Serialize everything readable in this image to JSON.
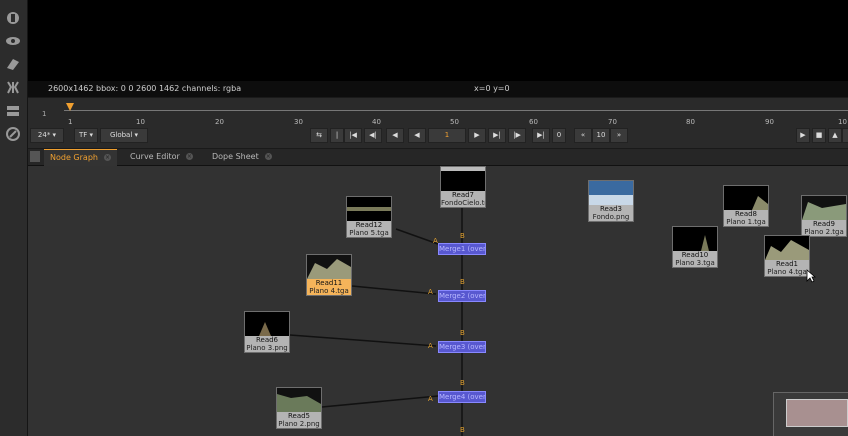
{
  "viewer": {
    "info_left": "2600x1462  bbox: 0 0 2600 1462 channels: rgba",
    "info_coords": "x=0 y=0"
  },
  "timeline": {
    "frame_start": "1",
    "ticks": [
      "1",
      "10",
      "20",
      "30",
      "40",
      "50",
      "60",
      "70",
      "80",
      "90",
      "10"
    ],
    "fps": "24*",
    "tf": "TF",
    "scope": "Global",
    "current_frame": "1",
    "end_marker": "0",
    "skip_value": "10"
  },
  "tabs": [
    {
      "label": "Node Graph",
      "active": true
    },
    {
      "label": "Curve Editor",
      "active": false
    },
    {
      "label": "Dope Sheet",
      "active": false
    }
  ],
  "nodes": [
    {
      "name": "Read7",
      "file": "FondoCielo.tga"
    },
    {
      "name": "Read12",
      "file": "Plano 5.tga"
    },
    {
      "name": "Read11",
      "file": "Plano 4.tga"
    },
    {
      "name": "Read6",
      "file": "Plano 3.png"
    },
    {
      "name": "Read5",
      "file": "Plano 2.png"
    },
    {
      "name": "Read3",
      "file": "Fondo.png"
    },
    {
      "name": "Read8",
      "file": "Plano 1.tga"
    },
    {
      "name": "Read10",
      "file": "Plano 3.tga"
    },
    {
      "name": "Read1",
      "file": "Plano 4.tga"
    },
    {
      "name": "Read9",
      "file": "Plano 2.tga"
    }
  ],
  "merges": [
    {
      "label": "Merge1 (over)"
    },
    {
      "label": "Merge2 (over)"
    },
    {
      "label": "Merge3 (over)"
    },
    {
      "label": "Merge4 (over)"
    }
  ],
  "pins": {
    "a": "A",
    "b": "B"
  },
  "colors": {
    "accent": "#f0a030",
    "merge": "#5858d0",
    "selected": "#f5b45a"
  }
}
